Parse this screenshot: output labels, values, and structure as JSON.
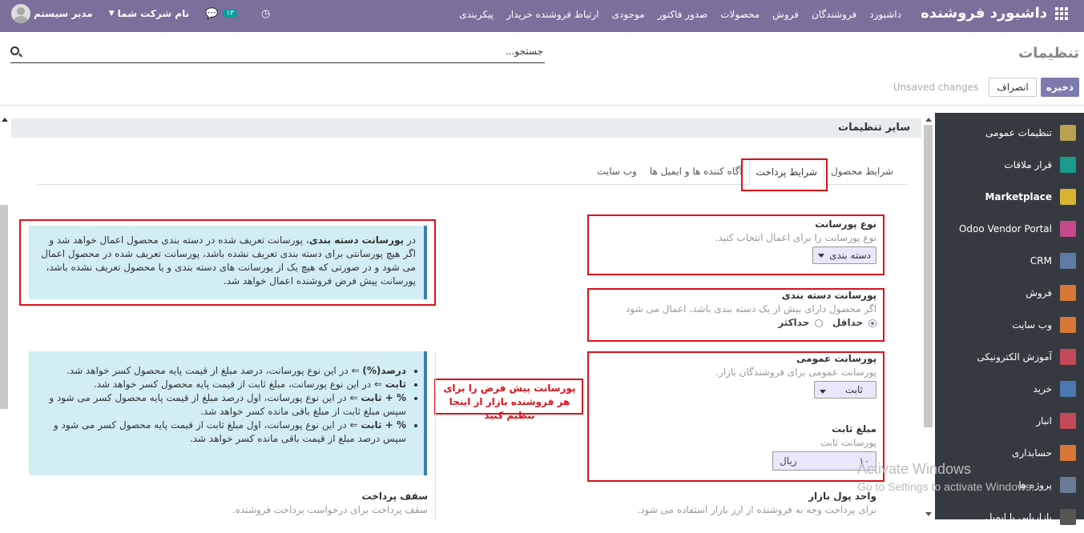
{
  "topbar": {
    "brand": "داشبورد فروشنده",
    "menu": [
      "داشبورد",
      "فروشندگان",
      "فروش",
      "محصولات",
      "صدور فاکتور",
      "موجودی",
      "ارتباط فروشنده خریدار",
      "پیکربندی"
    ],
    "messages_count": "۱۳",
    "company": "نام شرکت شما",
    "user": "مدیر سیستم"
  },
  "control": {
    "title": "تنظیمات",
    "search_placeholder": "جستجو...",
    "save_label": "ذخیره",
    "cancel_label": "انصراف",
    "unsaved": "Unsaved changes"
  },
  "sidebar": {
    "items": [
      {
        "label": "تنظیمات عمومی",
        "icon": "gear-icon",
        "color": "#b8a153"
      },
      {
        "label": "قرار ملاقات",
        "icon": "calendar-icon",
        "color": "#1a9b8c"
      },
      {
        "label": "Marketplace",
        "icon": "marketplace-icon",
        "color": "#d9b234",
        "active": true
      },
      {
        "label": "Odoo Vendor Portal",
        "icon": "portal-grid-icon",
        "color": "#c44a8c"
      },
      {
        "label": "CRM",
        "icon": "handshake-icon",
        "color": "#5e7ca6"
      },
      {
        "label": "فروش",
        "icon": "chart-icon",
        "color": "#d9773b"
      },
      {
        "label": "وب سایت",
        "icon": "globe-icon",
        "color": "#d9773b"
      },
      {
        "label": "آموزش الکترونیکی",
        "icon": "elearning-icon",
        "color": "#c44a5a"
      },
      {
        "label": "خرید",
        "icon": "card-icon",
        "color": "#4a78b0"
      },
      {
        "label": "انبار",
        "icon": "box-icon",
        "color": "#c44a5a"
      },
      {
        "label": "حسابداری",
        "icon": "invoice-icon",
        "color": "#d9773b"
      },
      {
        "label": "پروژه ها",
        "icon": "puzzle-icon",
        "color": "#6b7b96"
      },
      {
        "label": "بازاریابی با ایمیل",
        "icon": "mail-icon",
        "color": "#555"
      }
    ]
  },
  "section": {
    "title": "سایر تنظیمات",
    "tabs": [
      "شرایط محصول",
      "شرایط پرداخت",
      "آگاه کننده ها و ایمیل ها",
      "وب سایت"
    ],
    "active_tab": "شرایط پرداخت"
  },
  "fields": {
    "commission_type": {
      "label": "نوع پورسانت",
      "help": "نوع پورسانت را برای اعمال انتخاب کنید.",
      "value": "دسته بندی"
    },
    "category_commission": {
      "label": "پورسانت دسته بندی",
      "help": "اگر محصول دارای بیش از یک دسته بندی باشد، اعمال می شود",
      "opt_min": "حداقل",
      "opt_max": "حداکثر"
    },
    "global_commission": {
      "label": "پورسانت عمومی",
      "help": "پورسانت عمومی برای فروشندگان بازار.",
      "value": "ثابت"
    },
    "fixed_amount": {
      "label": "مبلغ ثابت",
      "help": "پورسانت ثابت",
      "value": "۱۰",
      "currency": "ریال"
    },
    "currency": {
      "label": "واحد پول بازار",
      "help": "برای پرداخت وجه به فروشنده از ارز بازار استفاده می شود."
    },
    "payment_limit": {
      "label": "سقف پرداخت",
      "help": "سقف پرداخت برای درخواست پرداخت فروشنده."
    }
  },
  "alert1": {
    "pre": "در ",
    "bold": "پورسانت دسته بندی",
    "text": "، پورسانت تعریف شده در دسته بندی محصول اعمال خواهد شد و اگر هیچ پورسانتی برای دسته بندی تعریف نشده باشد، پورسانت تعریف شده در محصول اعمال می شود و در صورتی که هیچ یک از پورسانت های دسته بندی و یا محصول تعریف نشده باشد، پورسانت پیش فرض فروشنده اعمال خواهد شد."
  },
  "alert2": {
    "items": [
      {
        "bold": "درصد(%)",
        "text": " ⇐ در این نوع پورسانت، درصد مبلغ از قیمت پایه محصول کسر خواهد شد."
      },
      {
        "bold": "ثابت",
        "text": " ⇐ در این نوع پورسانت، مبلغ ثابت از قیمت پایه محصول کسر خواهد شد."
      },
      {
        "bold": "% + ثابت",
        "text": " ⇐ در این نوع پورسانت، اول درصد مبلغ از قیمت پایه محصول کسر می شود و سپس مبلغ ثابت از مبلغ باقی مانده کسر خواهد شد."
      },
      {
        "bold": "% + ثابت",
        "text": " ⇐ در این نوع پورسانت، اول مبلغ ثابت از قیمت پایه محصول کسر می شود و سپس درصد مبلغ از قیمت باقی مانده کسر خواهد شد."
      }
    ]
  },
  "annotation": "پورسانت پیش فرض را برای هر فروشنده بازار از اینجا تنظیم کنید",
  "watermark": {
    "line1": "Activate Windows",
    "line2": "Go to Settings to activate Windows."
  }
}
